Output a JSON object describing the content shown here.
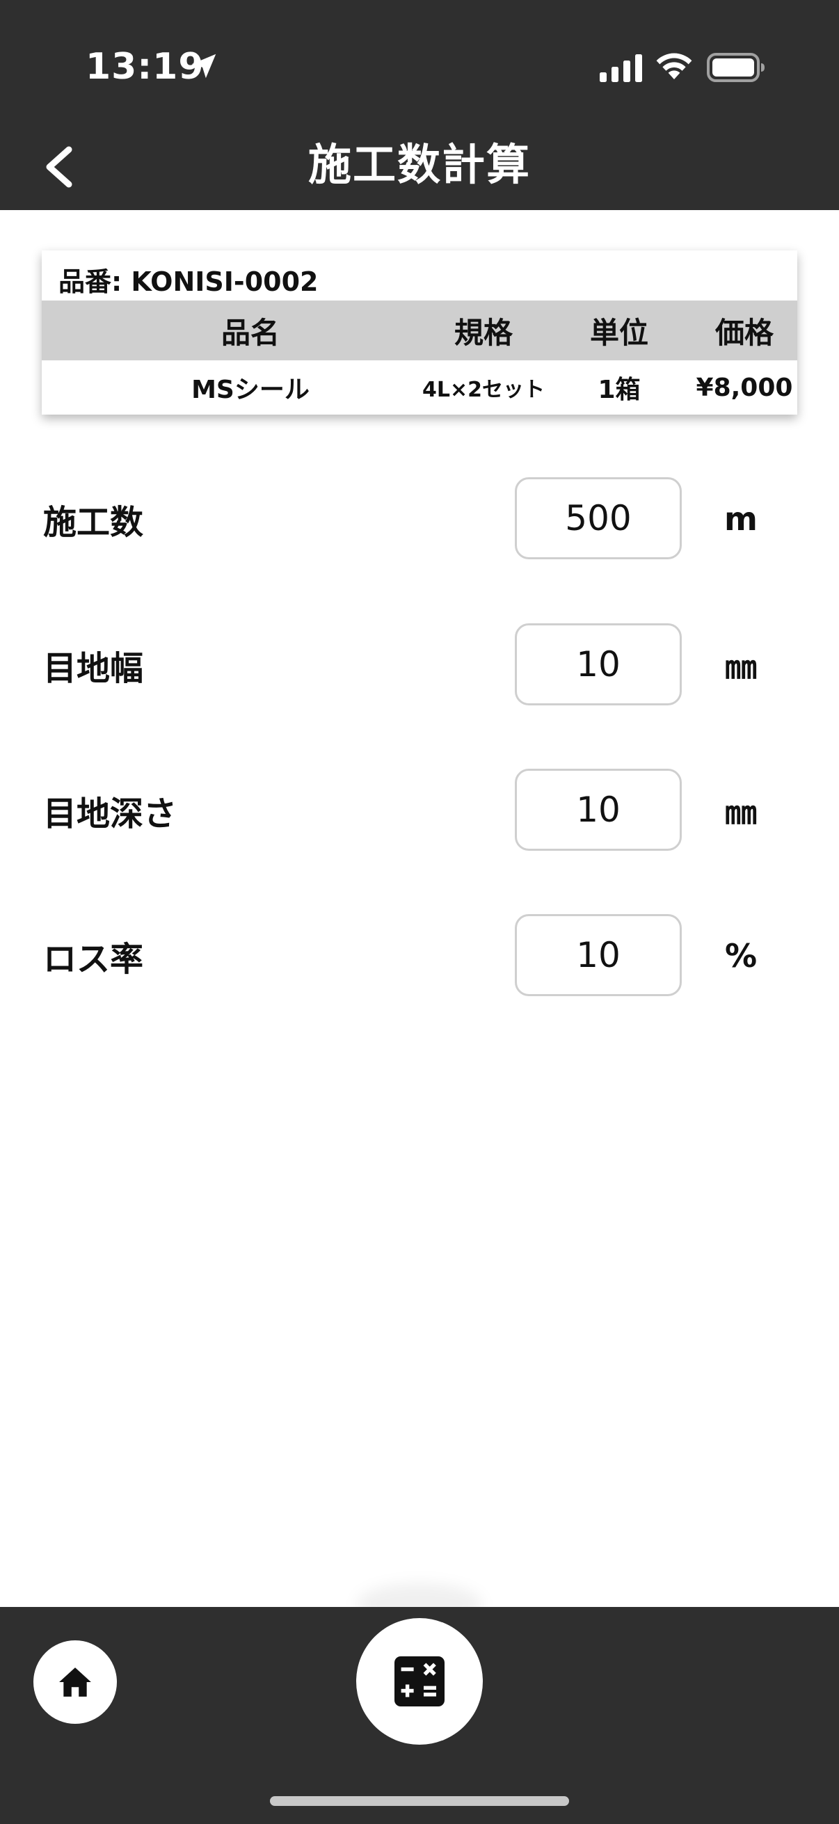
{
  "status_bar": {
    "time": "13:19"
  },
  "header": {
    "title": "施工数計算"
  },
  "product": {
    "code_label": "品番: KONISI-0002",
    "columns": [
      "品名",
      "規格",
      "単位",
      "価格"
    ],
    "row": [
      "MSシール",
      "4L×2セット",
      "1箱",
      "¥8,000"
    ]
  },
  "form": {
    "rows": [
      {
        "label": "施工数",
        "value": "500",
        "unit": "m"
      },
      {
        "label": "目地幅",
        "value": "10",
        "unit": "㎜"
      },
      {
        "label": "目地深さ",
        "value": "10",
        "unit": "㎜"
      },
      {
        "label": "ロス率",
        "value": "10",
        "unit": "%"
      }
    ]
  },
  "colors": {
    "bar_background": "#2f2f2f",
    "table_header_background": "#cfcfcf",
    "input_border": "#cfcfcf"
  }
}
